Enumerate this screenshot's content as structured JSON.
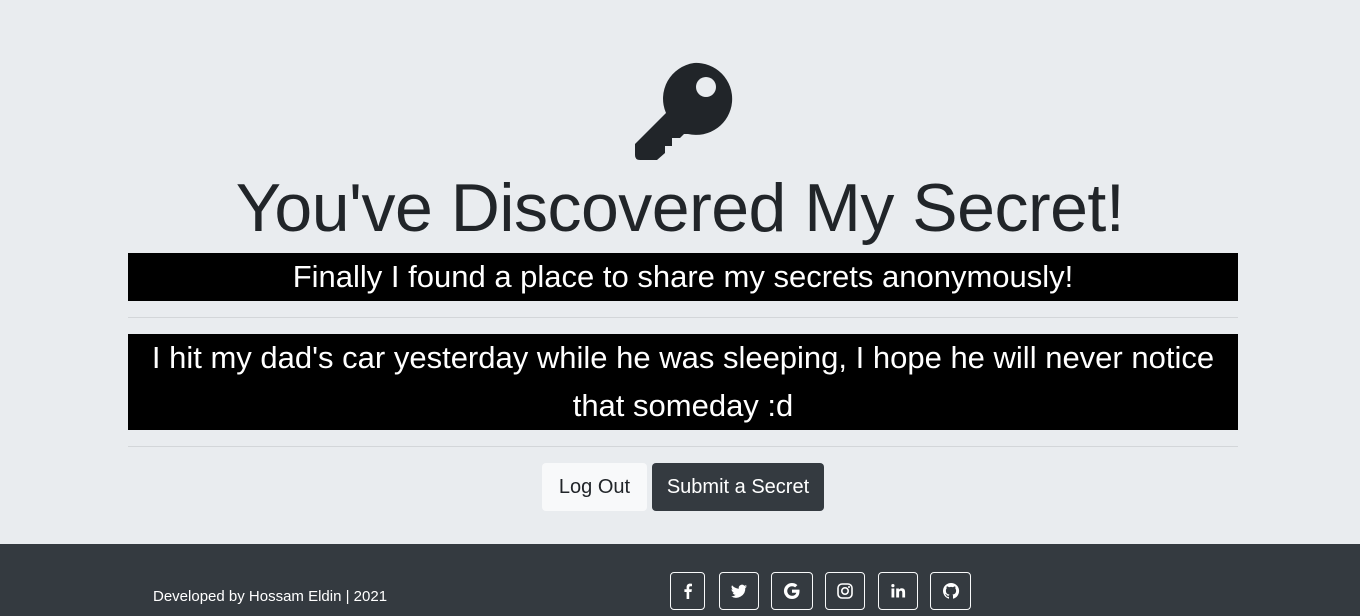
{
  "header": {
    "icon": "key-icon",
    "title": "You've Discovered My Secret!"
  },
  "secrets": [
    "Finally I found a place to share my secrets anonymously!",
    "I hit my dad's car yesterday while he was sleeping, I hope he will never notice that someday :d"
  ],
  "actions": {
    "logout_label": "Log Out",
    "submit_label": "Submit a Secret"
  },
  "footer": {
    "credit": "Developed by Hossam Eldin | 2021",
    "social_icons": [
      "facebook-icon",
      "twitter-icon",
      "google-icon",
      "instagram-icon",
      "linkedin-icon",
      "github-icon"
    ]
  },
  "colors": {
    "background": "#e9ecef",
    "secret_box": "#000000",
    "dark_button": "#343a40",
    "light_button": "#f8f9fa",
    "footer": "#343a40"
  }
}
